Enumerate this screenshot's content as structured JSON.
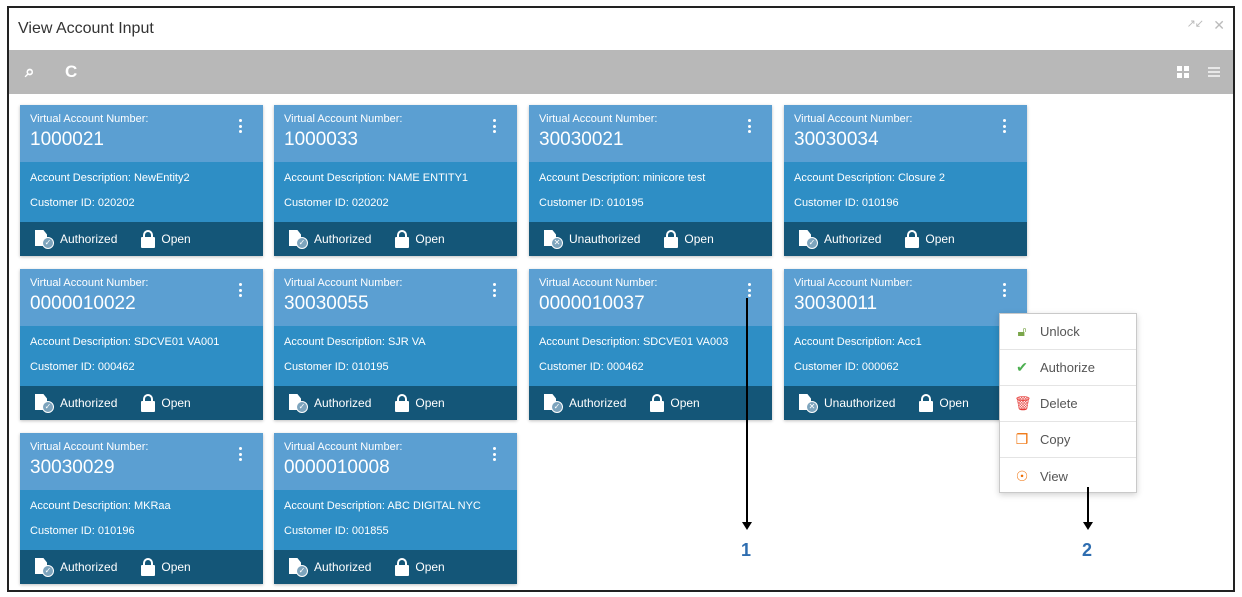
{
  "window": {
    "title": "View Account Input"
  },
  "toolbar": {
    "search_icon": "search-icon",
    "refresh_icon": "refresh-icon",
    "grid_icon": "grid-view-icon",
    "list_icon": "list-view-icon"
  },
  "colors": {
    "card_top": "#5b9fd2",
    "card_mid": "#2e8ec5",
    "card_bottom": "#145678",
    "toolbar": "#b8b8b8",
    "callout": "#2e6db0"
  },
  "card_label": "Virtual Account Number:",
  "desc_prefix": "Account Description:",
  "cust_prefix": "Customer ID:",
  "cards": [
    {
      "number": "1000021",
      "description": "NewEntity2",
      "customer_id": "020202",
      "auth": "Authorized",
      "lock": "Open"
    },
    {
      "number": "1000033",
      "description": "NAME ENTITY1",
      "customer_id": "020202",
      "auth": "Authorized",
      "lock": "Open"
    },
    {
      "number": "30030021",
      "description": "minicore test",
      "customer_id": "010195",
      "auth": "Unauthorized",
      "lock": "Open"
    },
    {
      "number": "30030034",
      "description": "Closure 2",
      "customer_id": "010196",
      "auth": "Authorized",
      "lock": "Open"
    },
    {
      "number": "0000010022",
      "description": "SDCVE01 VA001",
      "customer_id": "000462",
      "auth": "Authorized",
      "lock": "Open"
    },
    {
      "number": "30030055",
      "description": "SJR VA",
      "customer_id": "010195",
      "auth": "Authorized",
      "lock": "Open"
    },
    {
      "number": "0000010037",
      "description": "SDCVE01 VA003",
      "customer_id": "000462",
      "auth": "Authorized",
      "lock": "Open"
    },
    {
      "number": "30030011",
      "description": "Acc1",
      "customer_id": "000062",
      "auth": "Unauthorized",
      "lock": "Open"
    },
    {
      "number": "30030029",
      "description": "MKRaa",
      "customer_id": "010196",
      "auth": "Authorized",
      "lock": "Open"
    },
    {
      "number": "0000010008",
      "description": "ABC DIGITAL NYC",
      "customer_id": "001855",
      "auth": "Authorized",
      "lock": "Open"
    }
  ],
  "context_menu": [
    {
      "label": "Unlock",
      "icon": "unlock-icon"
    },
    {
      "label": "Authorize",
      "icon": "check-circle-icon"
    },
    {
      "label": "Delete",
      "icon": "trash-icon"
    },
    {
      "label": "Copy",
      "icon": "copy-icon"
    },
    {
      "label": "View",
      "icon": "view-icon"
    }
  ],
  "callouts": [
    "1",
    "2"
  ]
}
